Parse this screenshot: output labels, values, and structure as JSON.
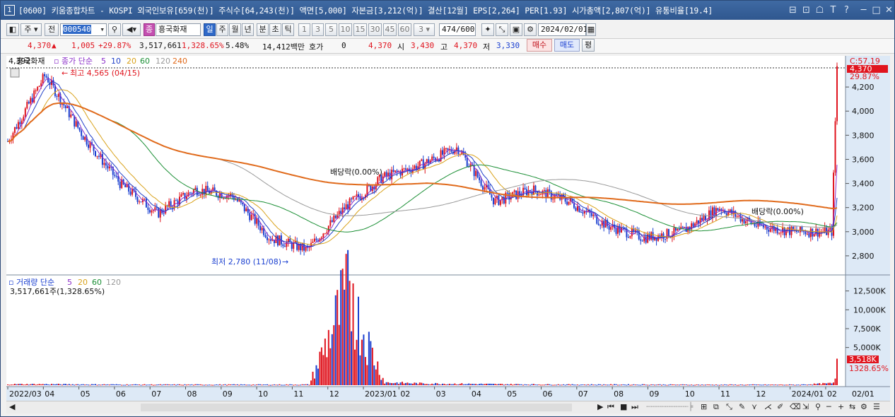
{
  "titlebar": {
    "window_num": "1",
    "title": "[0600] 키움종합차트 - KOSPI 외국인보유[659(천)] 주식수[64,243(천)] 액면[5,000] 자본금[3,212(억)] 결산[12월] EPS[2,264] PER[1.93] 시가총액[2,807(억)] 유통비율[19.4]",
    "buttons": [
      "⊟",
      "⊡",
      "☖",
      "T",
      "?",
      "─",
      "□",
      "✕"
    ]
  },
  "toolbar": {
    "mode_label": "주",
    "jeon_label": "전",
    "code_value": "000540",
    "stock_name": "흥국화재",
    "period_tabs": [
      "일",
      "주",
      "월",
      "년",
      "분",
      "초",
      "틱"
    ],
    "active_tab": "일",
    "interval_buttons": [
      "1",
      "3",
      "5",
      "10",
      "15",
      "30",
      "45",
      "60"
    ],
    "interval_select": "3",
    "count_value": "474",
    "count_total": "/600",
    "date_value": "2024/02/01"
  },
  "infobar": {
    "price": "4,370",
    "change": "1,005",
    "change_pct": "+29.87%",
    "volume": "3,517,661",
    "volume_pct": "1,328.65%",
    "turnover": "5.48%",
    "amount": "14,412백만",
    "hoga_label": "호가",
    "hoga_value": "0",
    "cur_price": "4,370",
    "open_label": "시",
    "open": "3,430",
    "high_label": "고",
    "high": "4,370",
    "low_label": "저",
    "low": "3,330",
    "buy_label": "매수",
    "sell_label": "매도",
    "eval_label": "평"
  },
  "chart": {
    "legend_price_value": "4,392",
    "legend_name": "흥국화재",
    "legend_ma_label": "종가 단순",
    "legend_ma": [
      "5",
      "10",
      "20",
      "60",
      "120",
      "240"
    ],
    "legend_ma_colors": [
      "#8b2fc9",
      "#1f3fc8",
      "#d9a21b",
      "#1b8f35",
      "#999999",
      "#e06a1b"
    ],
    "max_annotation": "최고 4,565 (04/15)",
    "min_annotation": "최저 2,780 (11/08)",
    "dividend1": "배당락(0.00%)",
    "dividend2": "배당락(0.00%)",
    "price_ticks": [
      "4,200",
      "4,000",
      "3,800",
      "3,600",
      "3,400",
      "3,200",
      "3,000",
      "2,800"
    ],
    "right_top": "C:57.19",
    "right_price": "4,370",
    "right_pct": "29.87%",
    "vol_legend": "거래량 단순",
    "vol_ma": [
      "5",
      "20",
      "60",
      "120"
    ],
    "vol_ma_colors": [
      "#8b2fc9",
      "#d9a21b",
      "#1b8f35",
      "#999999"
    ],
    "vol_value": "3,517,661주(1,328.65%)",
    "vol_ticks": [
      "12,500K",
      "10,000K",
      "7,500K",
      "5,000K"
    ],
    "vol_last": "3,518K",
    "vol_last_pct": "1328.65%",
    "x_labels": [
      "2022/03",
      "04",
      "05",
      "06",
      "07",
      "08",
      "09",
      "10",
      "11",
      "12",
      "2023/01",
      "02",
      "03",
      "04",
      "05",
      "06",
      "07",
      "08",
      "09",
      "10",
      "11",
      "12",
      "2024/01",
      "02"
    ],
    "x_right_label": "02/01",
    "colors": {
      "up": "#e0141e",
      "down": "#1a3fd0",
      "panel_right": "#dde9f6"
    }
  },
  "chart_data": {
    "type": "candlestick",
    "title": "흥국화재",
    "ylim": [
      2700,
      4400
    ],
    "x": [
      "2022/03",
      "2022/04",
      "2022/05",
      "2022/06",
      "2022/07",
      "2022/08",
      "2022/09",
      "2022/10",
      "2022/11",
      "2022/12",
      "2023/01",
      "2023/02",
      "2023/03",
      "2023/04",
      "2023/05",
      "2023/06",
      "2023/07",
      "2023/08",
      "2023/09",
      "2023/10",
      "2023/11",
      "2023/12",
      "2024/01",
      "2024/02/01"
    ],
    "close": [
      3750,
      4300,
      3800,
      3400,
      3150,
      3350,
      3300,
      2950,
      2850,
      3200,
      3450,
      3550,
      3700,
      3250,
      3350,
      3250,
      3050,
      2950,
      3000,
      3200,
      3050,
      3000,
      3000,
      4370
    ],
    "series": [
      {
        "name": "MA240",
        "values": [
          3800,
          3850,
          3870,
          3750,
          3600,
          3450,
          3350,
          3250,
          3200,
          3180,
          3180,
          3250,
          3350,
          3380,
          3400,
          3350,
          3250,
          3150,
          3100,
          3050,
          3050,
          3050,
          3050,
          3050
        ]
      }
    ],
    "volume_K": [
      150,
      150,
      120,
      100,
      90,
      90,
      90,
      90,
      100,
      13500,
      400,
      250,
      200,
      150,
      120,
      100,
      100,
      100,
      80,
      80,
      80,
      80,
      300,
      3518
    ],
    "vol_ylim": [
      0,
      13500
    ]
  }
}
